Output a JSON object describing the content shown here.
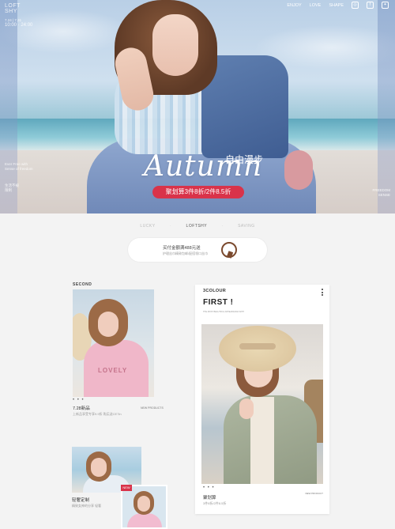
{
  "hero": {
    "brand_line1": "LOFT",
    "brand_line2": "SHY",
    "brand_date": "7.24 | 7.31",
    "brand_date2": "10:00 · 24:00",
    "side_left_1": "Ever Free with",
    "side_left_2": "Sense of freedom",
    "side_left_3": "生活不被",
    "side_left_4": "限制",
    "side_right_1": "FREEDOM",
    "side_right_2": "SENSE",
    "title": "Autumn",
    "subtitle": "自由漫步",
    "promo": "聚划算3件8折/2件8.5折"
  },
  "topnav": {
    "items": [
      "ENJOY",
      "LOVE",
      "SHAPE"
    ],
    "icons": [
      "instagram-icon",
      "facebook-icon",
      "twitter-icon"
    ]
  },
  "subnav": {
    "items": [
      "LUCKY",
      "LOFTSHY",
      "SAVING"
    ],
    "active": "LOFTSHY"
  },
  "coupon": {
    "line1": "买付金额满488元送",
    "line2": "护理丝巾精致包邮/配搭领口丝巾"
  },
  "left": {
    "section_label": "SECOND",
    "photo_text": "LOVELY",
    "dots": "• • •",
    "title": "7.28新品",
    "subtitle": "上新品享受专享9.9折    购买送CE7ln",
    "right_label": "NEW PRODUCTS",
    "second_title": "轻奢定制",
    "second_sub": "精致女神的分享 轻奢",
    "new_badge": "NEW"
  },
  "card": {
    "brand": "3COLOUR",
    "title": "FIRST !",
    "tiny": "THE MOST BEAUTIFUL APPEARANCE WITH",
    "dots": "• • •",
    "caption": "聚划算",
    "caption_sub": "3件8折/2件8.5折",
    "right_label": "NEW PRODUCT"
  },
  "colors": {
    "accent": "#d9334a",
    "background": "#f3f3f3"
  }
}
